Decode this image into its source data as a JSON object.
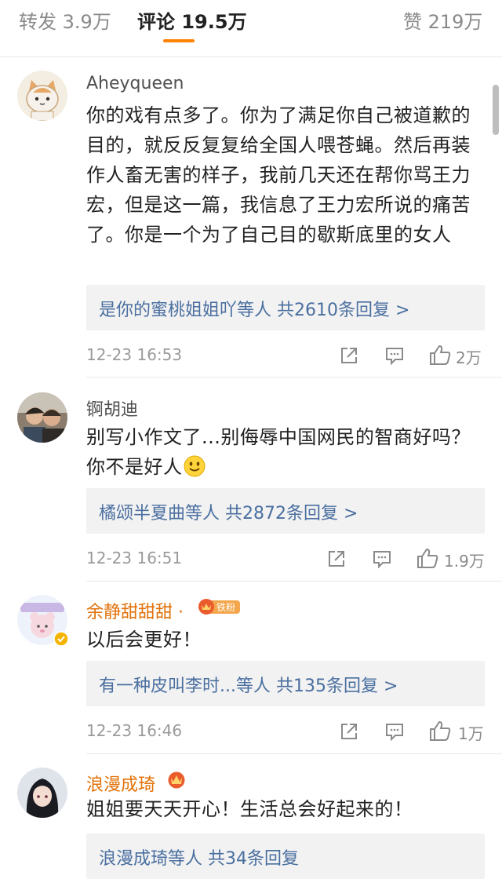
{
  "tabs": {
    "repost": "转发 3.9万",
    "comments": "评论 19.5万",
    "likes": "赞 219万"
  },
  "comments": [
    {
      "user": "Aheyqueen",
      "text": "你的戏有点多了。你为了满足你自己被道歉的目的，就反反复复给全国人喂苍蝇。然后再装作人畜无害的样子，我前几天还在帮你骂王力宏，但是这一篇，我信息了王力宏所说的痛苦了。你是一个为了自己目的歇斯底里的女人",
      "replies": "是你的蜜桃姐姐吖等人 共2610条回复 >",
      "time": "12-23 16:53",
      "likes": "2万"
    },
    {
      "user": "锕胡迪",
      "text": "别写小作文了...别侮辱中国网民的智商好吗？你不是好人",
      "replies": "橘颂半夏曲等人 共2872条回复 >",
      "time": "12-23 16:51",
      "likes": "1.9万"
    },
    {
      "user": "余静甜甜甜 ·",
      "badge": "铁粉",
      "text": "以后会更好！",
      "replies": "有一种皮叫李时...等人 共135条回复 >",
      "time": "12-23 16:46",
      "likes": "1万"
    },
    {
      "user": "浪漫成琦",
      "text": "姐姐要天天开心！生活总会好起来的！",
      "replies": "浪漫成琦等人 共34条回复"
    }
  ],
  "icons": {
    "share": "share-icon",
    "comment": "comment-icon",
    "like": "thumbs-up-icon",
    "emoji": "smile-emoji-icon",
    "crown": "crown-icon",
    "verified": "verified-icon"
  },
  "colors": {
    "accent": "#ff8200",
    "link": "#4a6fa0",
    "vip_name": "#e2720a"
  }
}
